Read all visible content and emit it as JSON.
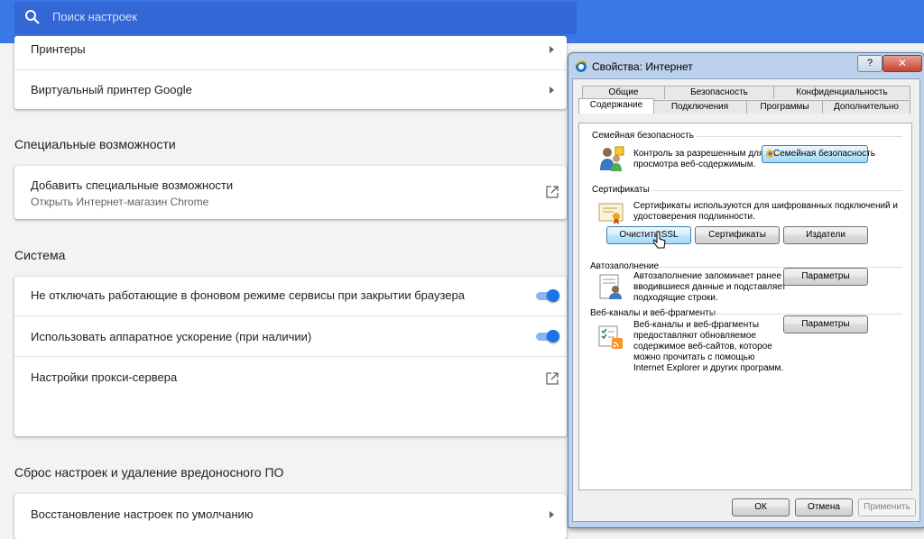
{
  "search": {
    "placeholder": "Поиск настроек"
  },
  "printers_card": {
    "items": [
      {
        "label": "Принтеры"
      },
      {
        "label": "Виртуальный принтер Google"
      }
    ]
  },
  "accessibility": {
    "heading": "Специальные возможности",
    "item_label": "Добавить специальные возможности",
    "item_sub": "Открыть Интернет-магазин Chrome"
  },
  "system": {
    "heading": "Система",
    "items": [
      {
        "label": "Не отключать работающие в фоновом режиме сервисы при закрытии браузера",
        "on": true
      },
      {
        "label": "Использовать аппаратное ускорение (при наличии)",
        "on": true
      },
      {
        "label": "Настройки прокси-сервера"
      }
    ]
  },
  "reset": {
    "heading": "Сброс настроек и удаление вредоносного ПО",
    "item_label": "Восстановление настроек по умолчанию"
  },
  "dialog": {
    "title": "Свойства: Интернет",
    "help": "?",
    "close": "✕",
    "tabs_row1": [
      "Общие",
      "Безопасность",
      "Конфиденциальность"
    ],
    "tabs_row2": [
      "Содержание",
      "Подключения",
      "Программы",
      "Дополнительно"
    ],
    "active_tab": "Содержание",
    "family": {
      "label": "Семейная безопасность",
      "text": "Контроль за разрешенным для просмотра веб-содержимым.",
      "button": "Семейная безопасность"
    },
    "certs": {
      "label": "Сертификаты",
      "text": "Сертификаты используются для шифрованных подключений и удостоверения подлинности.",
      "buttons": [
        "Очистить SSL",
        "Сертификаты",
        "Издатели"
      ]
    },
    "autofill": {
      "label": "Автозаполнение",
      "text": "Автозаполнение запоминает ранее вводившиеся данные и подставляет подходящие строки.",
      "button": "Параметры"
    },
    "feeds": {
      "label": "Веб-каналы и веб-фрагменты",
      "text": "Веб-каналы и веб-фрагменты предоставляют обновляемое содержимое веб-сайтов, которое можно прочитать с помощью Internet Explorer и других программ.",
      "button": "Параметры"
    },
    "footer": {
      "ok": "ОК",
      "cancel": "Отмена",
      "apply": "Применить"
    }
  },
  "colors": {
    "chrome_blue": "#3b78e7",
    "toggle": "#1a73e8"
  }
}
